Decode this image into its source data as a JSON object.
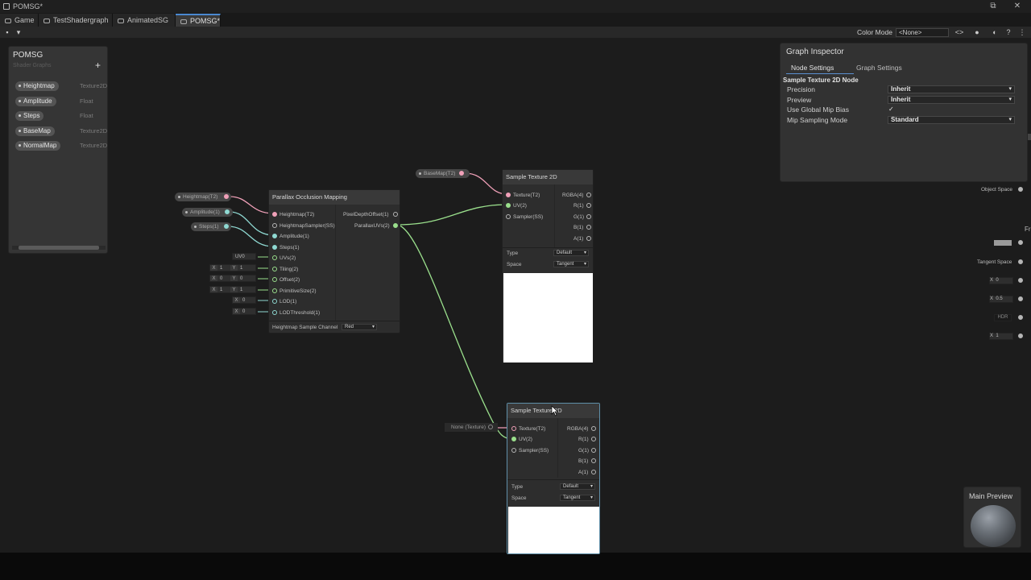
{
  "window": {
    "title": "POMSG*",
    "controls": [
      "⧉",
      "✕"
    ]
  },
  "tabs": [
    {
      "label": "Game"
    },
    {
      "label": "TestShadergraph"
    },
    {
      "label": "AnimatedSG"
    },
    {
      "label": "POMSG*"
    }
  ],
  "toolbar": {
    "color_mode_label": "Color Mode",
    "color_mode_value": "<None>",
    "icons": [
      "save-icon",
      "dropdown-icon",
      "code-icon",
      "info-icon",
      "sphere-icon",
      "help-icon",
      "more-icon"
    ]
  },
  "blackboard": {
    "title": "POMSG",
    "subtitle": "Shader Graphs",
    "add": "+",
    "properties": [
      {
        "name": "Heightmap",
        "type": "Texture2D"
      },
      {
        "name": "Amplitude",
        "type": "Float"
      },
      {
        "name": "Steps",
        "type": "Float"
      },
      {
        "name": "BaseMap",
        "type": "Texture2D"
      },
      {
        "name": "NormalMap",
        "type": "Texture2D"
      }
    ]
  },
  "pom_node": {
    "title": "Parallax Occlusion Mapping",
    "inputs": [
      "Heightmap(T2)",
      "HeightmapSampler(SS)",
      "Amplitude(1)",
      "Steps(1)",
      "UVs(2)",
      "Tiling(2)",
      "Offset(2)",
      "PrimitiveSize(2)",
      "LOD(1)",
      "LODThreshold(1)"
    ],
    "outputs": [
      "PixelDepthOffset(1)",
      "ParallaxUVs(2)"
    ],
    "channel_label": "Heightmap Sample Channel",
    "channel_value": "Red"
  },
  "pom_inputs": {
    "heightmap_chip": "Heightmap(T2)",
    "amplitude_chip": "Amplitude(1)",
    "steps_chip": "Steps(1)",
    "uv_select": "UV0",
    "tiling": {
      "x_key": "X",
      "x": "1",
      "y_key": "Y",
      "y": "1"
    },
    "offset": {
      "x_key": "X",
      "x": "0",
      "y_key": "Y",
      "y": "0"
    },
    "prim_size": {
      "x_key": "X",
      "x": "1",
      "y_key": "Y",
      "y": "1"
    },
    "lod": {
      "key": "X",
      "value": "0"
    },
    "lod_threshold": {
      "key": "X",
      "value": "0"
    }
  },
  "sample_node_1": {
    "title": "Sample Texture 2D",
    "inputs": [
      "Texture(T2)",
      "UV(2)",
      "Sampler(SS)"
    ],
    "outputs": [
      "RGBA(4)",
      "R(1)",
      "G(1)",
      "B(1)",
      "A(1)"
    ],
    "type_label": "Type",
    "type_value": "Default",
    "space_label": "Space",
    "space_value": "Tangent",
    "basemap_chip": "BaseMap(T2)"
  },
  "sample_node_2": {
    "title": "Sample Texture 2D",
    "inputs": [
      "Texture(T2)",
      "UV(2)",
      "Sampler(SS)"
    ],
    "outputs": [
      "RGBA(4)",
      "R(1)",
      "G(1)",
      "B(1)",
      "A(1)"
    ],
    "type_label": "Type",
    "type_value": "Default",
    "space_label": "Space",
    "space_value": "Tangent",
    "texture_chip": "None (Texture)"
  },
  "inspector": {
    "title": "Graph Inspector",
    "tabs": [
      "Node Settings",
      "Graph Settings"
    ],
    "section": "Sample Texture 2D Node",
    "rows": [
      {
        "label": "Precision",
        "value": "Inherit"
      },
      {
        "label": "Preview",
        "value": "Inherit"
      },
      {
        "label": "Use Global Mip Bias",
        "value": "✓"
      },
      {
        "label": "Mip Sampling Mode",
        "value": "Standard"
      }
    ]
  },
  "right_edge": {
    "object_space": "Object Space",
    "tangent_space": "Tangent Space",
    "x_key": "X",
    "x0": "0",
    "x05": "0.5",
    "hdr": "HDR",
    "x1": "1",
    "fr": "Fr"
  },
  "main_preview": {
    "title": "Main Preview"
  },
  "colors": {
    "texture_port": "#f0a0b8",
    "vector2_port": "#9adf8c",
    "float_port": "#8fd9d2",
    "accent": "#4a88d0"
  }
}
